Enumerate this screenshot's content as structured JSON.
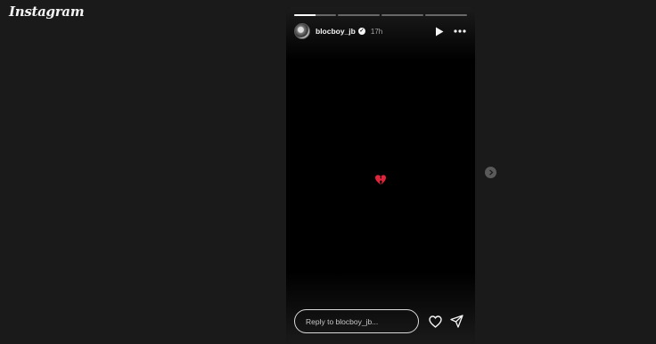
{
  "app": {
    "brand": "Instagram"
  },
  "story": {
    "progress": [
      0.5,
      0,
      0,
      0
    ],
    "user": {
      "username": "blocboy_jb",
      "verified": true,
      "time_ago": "17h"
    },
    "content": {
      "emoji": "💔"
    },
    "reply": {
      "placeholder": "Reply to blocboy_jb..."
    }
  },
  "icons": {
    "play": "play-icon",
    "more": "more-options-icon",
    "like": "heart-icon",
    "share": "send-icon",
    "next": "chevron-right-icon",
    "verified": "verified-badge-icon"
  },
  "colors": {
    "background": "#1a1a1a",
    "story_background": "#000000",
    "text": "#f5f5f5",
    "secondary_text": "#a8a8a8"
  }
}
